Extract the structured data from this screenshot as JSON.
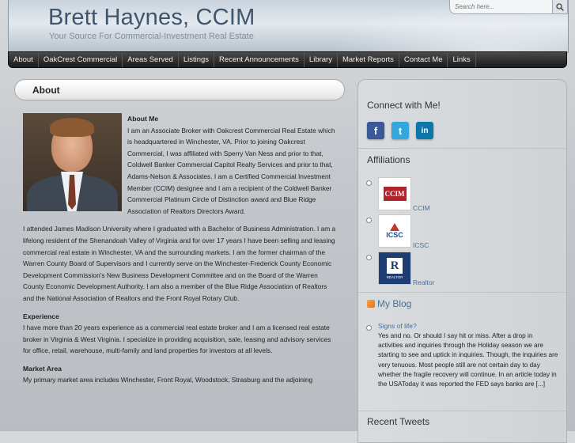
{
  "header": {
    "site_title": "Brett Haynes, CCIM",
    "tagline": "Your Source For Commercial-Investment Real Estate",
    "search_placeholder": "Search here..."
  },
  "nav": {
    "items": [
      "About",
      "OakCrest Commercial",
      "Areas Served",
      "Listings",
      "Recent Announcements",
      "Library",
      "Market Reports",
      "Contact Me",
      "Links"
    ]
  },
  "main": {
    "page_title": "About",
    "about_heading": "About Me",
    "about_text": "I am an Associate Broker with Oakcrest Commercial Real Estate which is headquartered in Winchester, VA. Prior to joining Oakcrest Commercial, I was affiliated with Sperry Van Ness and prior to that, Coldwell Banker Commercial Capitol Realty Services and prior to that, Adams-Nelson & Associates. I am a Certified Commercial Investment Member (CCIM) designee and I am a recipient of the Coldwell Banker Commercial Platinum Circle of Distinction award and Blue Ridge Association of Realtors Directors Award.",
    "education_text": "I attended James Madison University where I graduated with a Bachelor of Business Administration.  I am a lifelong resident of the Shenandoah Valley of Virginia and for over 17 years I have been selling and leasing commercial real estate in Winchester, VA and the surrounding markets. I am the former chairman of the Warren County Board of Supervisors and I currently serve on the Winchester-Frederick County Economic Development Commission's New Business Development Committee and on the Board of the Warren County Economic Development Authority. I am also a member of the Blue Ridge Association of Realtors and the National Association of Realtors and the Front Royal Rotary Club.",
    "experience_heading": "Experience",
    "experience_text": "I have more than 20 years experience as a commercial real estate broker and I am a licensed real estate broker in Virginia & West Virginia. I specialize in providing acquisition, sale, leasing and advisory services for office, retail, warehouse, multi-family and land properties for investors at all levels.",
    "market_heading": "Market Area",
    "market_text": "My primary market area includes Winchester, Front Royal, Woodstock, Strasburg  and the adjoining"
  },
  "sidebar": {
    "connect_title": "Connect with Me!",
    "social": [
      {
        "icon": "facebook-icon",
        "glyph": "f",
        "color": "#3b5998"
      },
      {
        "icon": "twitter-icon",
        "glyph": "t",
        "color": "#33a6dc"
      },
      {
        "icon": "linkedin-icon",
        "glyph": "in",
        "color": "#0e76a8"
      }
    ],
    "affiliations_title": "Affiliations",
    "affiliations": [
      {
        "name": "CCIM",
        "logo_text": "CCIM"
      },
      {
        "name": "ICSC",
        "logo_text": "ICSC"
      },
      {
        "name": "Realtor",
        "logo_text": "R",
        "logo_sub": "REALTOR"
      }
    ],
    "blog_title": "My Blog",
    "blog_post_title": "Signs of life?",
    "blog_post_text": "Yes and no. Or should I say hit or miss. After a drop in activities and inquiries through the Holiday season we are starting to see and uptick in inquiries. Though, the inquiries are very tenuous. Most people still are not certain day to day whether the fragile recovery will continue. In an article today in the USAToday it was reported the FED says banks are [...]",
    "tweets_title": "Recent Tweets"
  }
}
